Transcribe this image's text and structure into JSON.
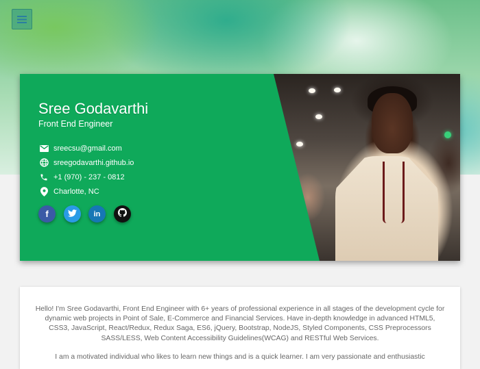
{
  "header": {
    "menu_icon": "hamburger-menu-icon"
  },
  "profile": {
    "name": "Sree Godavarthi",
    "role": "Front End Engineer",
    "contacts": [
      {
        "icon": "email-icon",
        "text": "sreecsu@gmail.com"
      },
      {
        "icon": "globe-icon",
        "text": "sreegodavarthi.github.io"
      },
      {
        "icon": "phone-icon",
        "text": "+1 (970) - 237 - 0812"
      },
      {
        "icon": "location-pin-icon",
        "text": "Charlotte, NC"
      }
    ],
    "socials": [
      {
        "icon": "facebook-icon",
        "glyph": "f",
        "color": "#3b5aa6"
      },
      {
        "icon": "twitter-icon",
        "color": "#2a9be6"
      },
      {
        "icon": "linkedin-icon",
        "glyph": "in",
        "color": "#1677b5"
      },
      {
        "icon": "github-icon",
        "color": "#111111"
      }
    ],
    "accent_color": "#0fa95a"
  },
  "about": {
    "paragraph1": "Hello! I'm Sree Godavarthi, Front End Engineer with 6+ years of professional experience in all stages of the development cycle for dynamic web projects in Point of Sale, E-Commerce and Financial Services. Have in-depth knowledge in advanced HTML5, CSS3, JavaScript, React/Redux, Redux Saga, ES6, jQuery, Bootstrap, NodeJS, Styled Components, CSS Preprocessors SASS/LESS, Web Content Accessibility Guidelines(WCAG) and RESTful Web Services.",
    "paragraph2": "I am a motivated individual who likes to learn new things and is a quick learner. I am very passionate and enthusiastic"
  }
}
